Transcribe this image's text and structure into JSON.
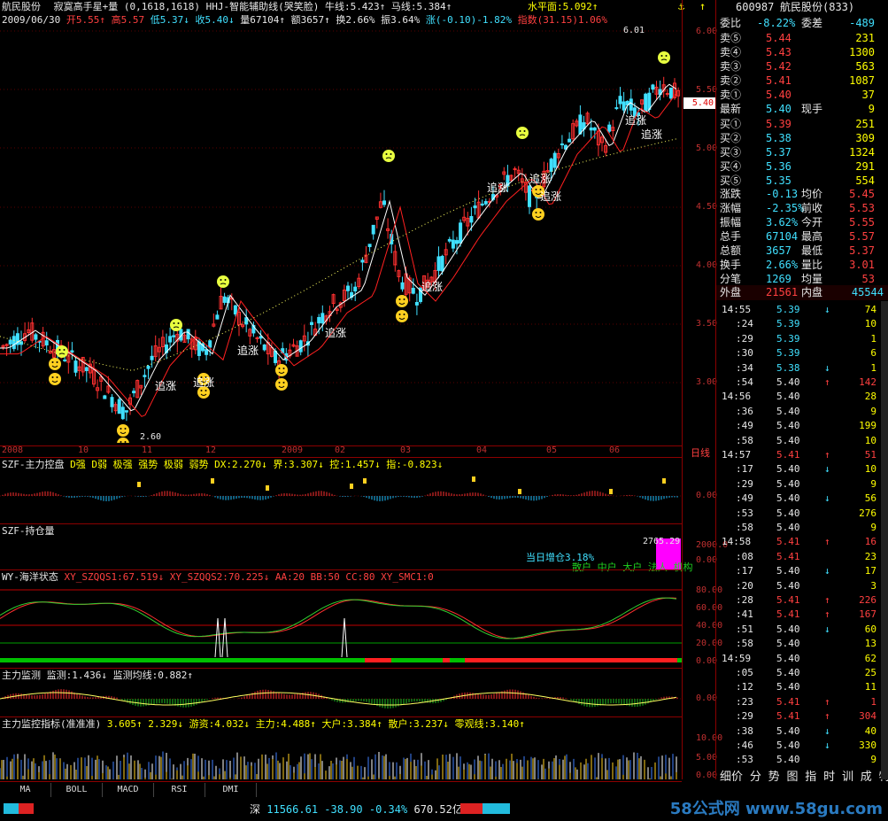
{
  "header": {
    "stock_name": "航民股份",
    "indicator_line": "寂寞高手星+量 (0,1618,1618) HHJ-智能辅助线(哭笑脸) 牛线:5.423↑ 马线:5.384↑",
    "water_level": "水平面:5.092↑",
    "date": "2009/06/30",
    "open": "开5.55↑",
    "high": "高5.57",
    "low": "低5.37↓",
    "close": "收5.40↓",
    "volume": "量67104↑",
    "amount": "额3657↑",
    "turnover": "换2.66%",
    "amplitude": "振3.64%",
    "change": "涨(-0.10)-1.82%",
    "index": "指数(31.15)1.06%"
  },
  "main_chart": {
    "y_ticks": [
      "6.00",
      "5.50",
      "5.00",
      "4.50",
      "4.00",
      "3.50",
      "3.00"
    ],
    "current_price": "5.40",
    "high_label": "6.01",
    "low_label": "2.60",
    "x_labels": [
      "2008",
      "10",
      "11",
      "12",
      "2009",
      "02",
      "03",
      "04",
      "05",
      "06"
    ],
    "period": "日线",
    "annotation": "追涨"
  },
  "panels": {
    "szf_main": {
      "title": "SZF-主力控盘",
      "legend": "D强 D弱 极强 强势 极弱 弱势 DX:2.270↓ 界:3.307↓ 控:1.457↓ 指:-0.823↓",
      "tick": "0.00"
    },
    "szf_pos": {
      "title": "SZF-持仓量",
      "tick1": "2000.0",
      "tick2": "0.00",
      "info": "当日增仓3.18%",
      "value": "2765.29",
      "legend": "散户 中户 大户 法人 机构"
    },
    "wy": {
      "title": "WY-海洋状态",
      "legend": "XY_SZQQS1:67.519↓ XY_SZQQS2:70.225↓ AA:20 BB:50 CC:80 XY_SMC1:0",
      "ticks": [
        "80.00",
        "60.00",
        "40.00",
        "20.00",
        "0.00"
      ]
    },
    "zljc": {
      "title": "主力监测",
      "legend": "监测:1.436↓ 监测均线:0.882↑",
      "tick": "0.00"
    },
    "zlkz": {
      "title": "主力监控指标(准准准)",
      "legend": "3.605↑ 2.329↓ 游资:4.032↓ 主力:4.488↑ 大户:3.384↑ 散户:3.237↓ 零观线:3.140↑",
      "ticks": [
        "10.00",
        "5.00",
        "0.00"
      ]
    }
  },
  "tabs": [
    "MA",
    "BOLL",
    "MACD",
    "RSI",
    "DMI"
  ],
  "status": {
    "index_name": "深",
    "index_value": "11566.61",
    "change": "-38.90",
    "pct": "-0.34%",
    "amount": "670.52亿"
  },
  "quote": {
    "code": "600987",
    "name": "航民股份(833)",
    "ratio_label": "委比",
    "ratio": "-8.22%",
    "diff_label": "委差",
    "diff": "-489",
    "asks": [
      {
        "label": "卖⑤",
        "price": "5.44",
        "vol": "231"
      },
      {
        "label": "卖④",
        "price": "5.43",
        "vol": "1300"
      },
      {
        "label": "卖③",
        "price": "5.42",
        "vol": "563"
      },
      {
        "label": "卖②",
        "price": "5.41",
        "vol": "1087"
      },
      {
        "label": "卖①",
        "price": "5.40",
        "vol": "37"
      }
    ],
    "last_label": "最新",
    "last": "5.40",
    "hand_label": "现手",
    "hand": "9",
    "bids": [
      {
        "label": "买①",
        "price": "5.39",
        "vol": "251"
      },
      {
        "label": "买②",
        "price": "5.38",
        "vol": "309"
      },
      {
        "label": "买③",
        "price": "5.37",
        "vol": "1324"
      },
      {
        "label": "买④",
        "price": "5.36",
        "vol": "291"
      },
      {
        "label": "买⑤",
        "price": "5.35",
        "vol": "554"
      }
    ],
    "stats": [
      {
        "l1": "涨跌",
        "v1": "-0.13",
        "l2": "均价",
        "v2": "5.45"
      },
      {
        "l1": "涨幅",
        "v1": "-2.35%",
        "l2": "前收",
        "v2": "5.53"
      },
      {
        "l1": "振幅",
        "v1": "3.62%",
        "l2": "今开",
        "v2": "5.55"
      },
      {
        "l1": "总手",
        "v1": "67104",
        "l2": "最高",
        "v2": "5.57"
      },
      {
        "l1": "总额",
        "v1": "3657",
        "l2": "最低",
        "v2": "5.37"
      },
      {
        "l1": "换手",
        "v1": "2.66%",
        "l2": "量比",
        "v2": "3.01"
      },
      {
        "l1": "分笔",
        "v1": "1269",
        "l2": "均量",
        "v2": "53"
      }
    ],
    "outer_label": "外盘",
    "outer": "21561",
    "inner_label": "内盘",
    "inner": "45544"
  },
  "ticks": [
    {
      "t": "14:55",
      "p": "5.39",
      "v": "74",
      "d": "↓"
    },
    {
      "t": ":24",
      "p": "5.39",
      "v": "10",
      "d": ""
    },
    {
      "t": ":29",
      "p": "5.39",
      "v": "1",
      "d": ""
    },
    {
      "t": ":30",
      "p": "5.39",
      "v": "6",
      "d": ""
    },
    {
      "t": ":34",
      "p": "5.38",
      "v": "1",
      "d": "↓"
    },
    {
      "t": ":54",
      "p": "5.40",
      "v": "142",
      "d": "↑"
    },
    {
      "t": "14:56",
      "p": "5.40",
      "v": "28",
      "d": ""
    },
    {
      "t": ":36",
      "p": "5.40",
      "v": "9",
      "d": ""
    },
    {
      "t": ":49",
      "p": "5.40",
      "v": "199",
      "d": ""
    },
    {
      "t": ":58",
      "p": "5.40",
      "v": "10",
      "d": ""
    },
    {
      "t": "14:57",
      "p": "5.41",
      "v": "51",
      "d": "↑"
    },
    {
      "t": ":17",
      "p": "5.40",
      "v": "10",
      "d": "↓"
    },
    {
      "t": ":29",
      "p": "5.40",
      "v": "9",
      "d": ""
    },
    {
      "t": ":49",
      "p": "5.40",
      "v": "56",
      "d": "↓"
    },
    {
      "t": ":53",
      "p": "5.40",
      "v": "276",
      "d": ""
    },
    {
      "t": ":58",
      "p": "5.40",
      "v": "9",
      "d": ""
    },
    {
      "t": "14:58",
      "p": "5.41",
      "v": "16",
      "d": "↑"
    },
    {
      "t": ":08",
      "p": "5.41",
      "v": "23",
      "d": ""
    },
    {
      "t": ":17",
      "p": "5.40",
      "v": "17",
      "d": "↓"
    },
    {
      "t": ":20",
      "p": "5.40",
      "v": "3",
      "d": ""
    },
    {
      "t": ":28",
      "p": "5.41",
      "v": "226",
      "d": "↑"
    },
    {
      "t": ":41",
      "p": "5.41",
      "v": "167",
      "d": "↑"
    },
    {
      "t": ":51",
      "p": "5.40",
      "v": "60",
      "d": "↓"
    },
    {
      "t": ":58",
      "p": "5.40",
      "v": "13",
      "d": ""
    },
    {
      "t": "14:59",
      "p": "5.40",
      "v": "62",
      "d": ""
    },
    {
      "t": ":05",
      "p": "5.40",
      "v": "25",
      "d": ""
    },
    {
      "t": ":12",
      "p": "5.40",
      "v": "11",
      "d": ""
    },
    {
      "t": ":23",
      "p": "5.41",
      "v": "1",
      "d": "↑"
    },
    {
      "t": ":29",
      "p": "5.41",
      "v": "304",
      "d": "↑"
    },
    {
      "t": ":38",
      "p": "5.40",
      "v": "40",
      "d": "↓"
    },
    {
      "t": ":46",
      "p": "5.40",
      "v": "330",
      "d": "↓"
    },
    {
      "t": ":53",
      "p": "5.40",
      "v": "9",
      "d": ""
    }
  ],
  "bottom_tabs": "细价  分 势 图 指 时 训 成 特 都",
  "watermark": "58公式网 www.58gu.com"
}
